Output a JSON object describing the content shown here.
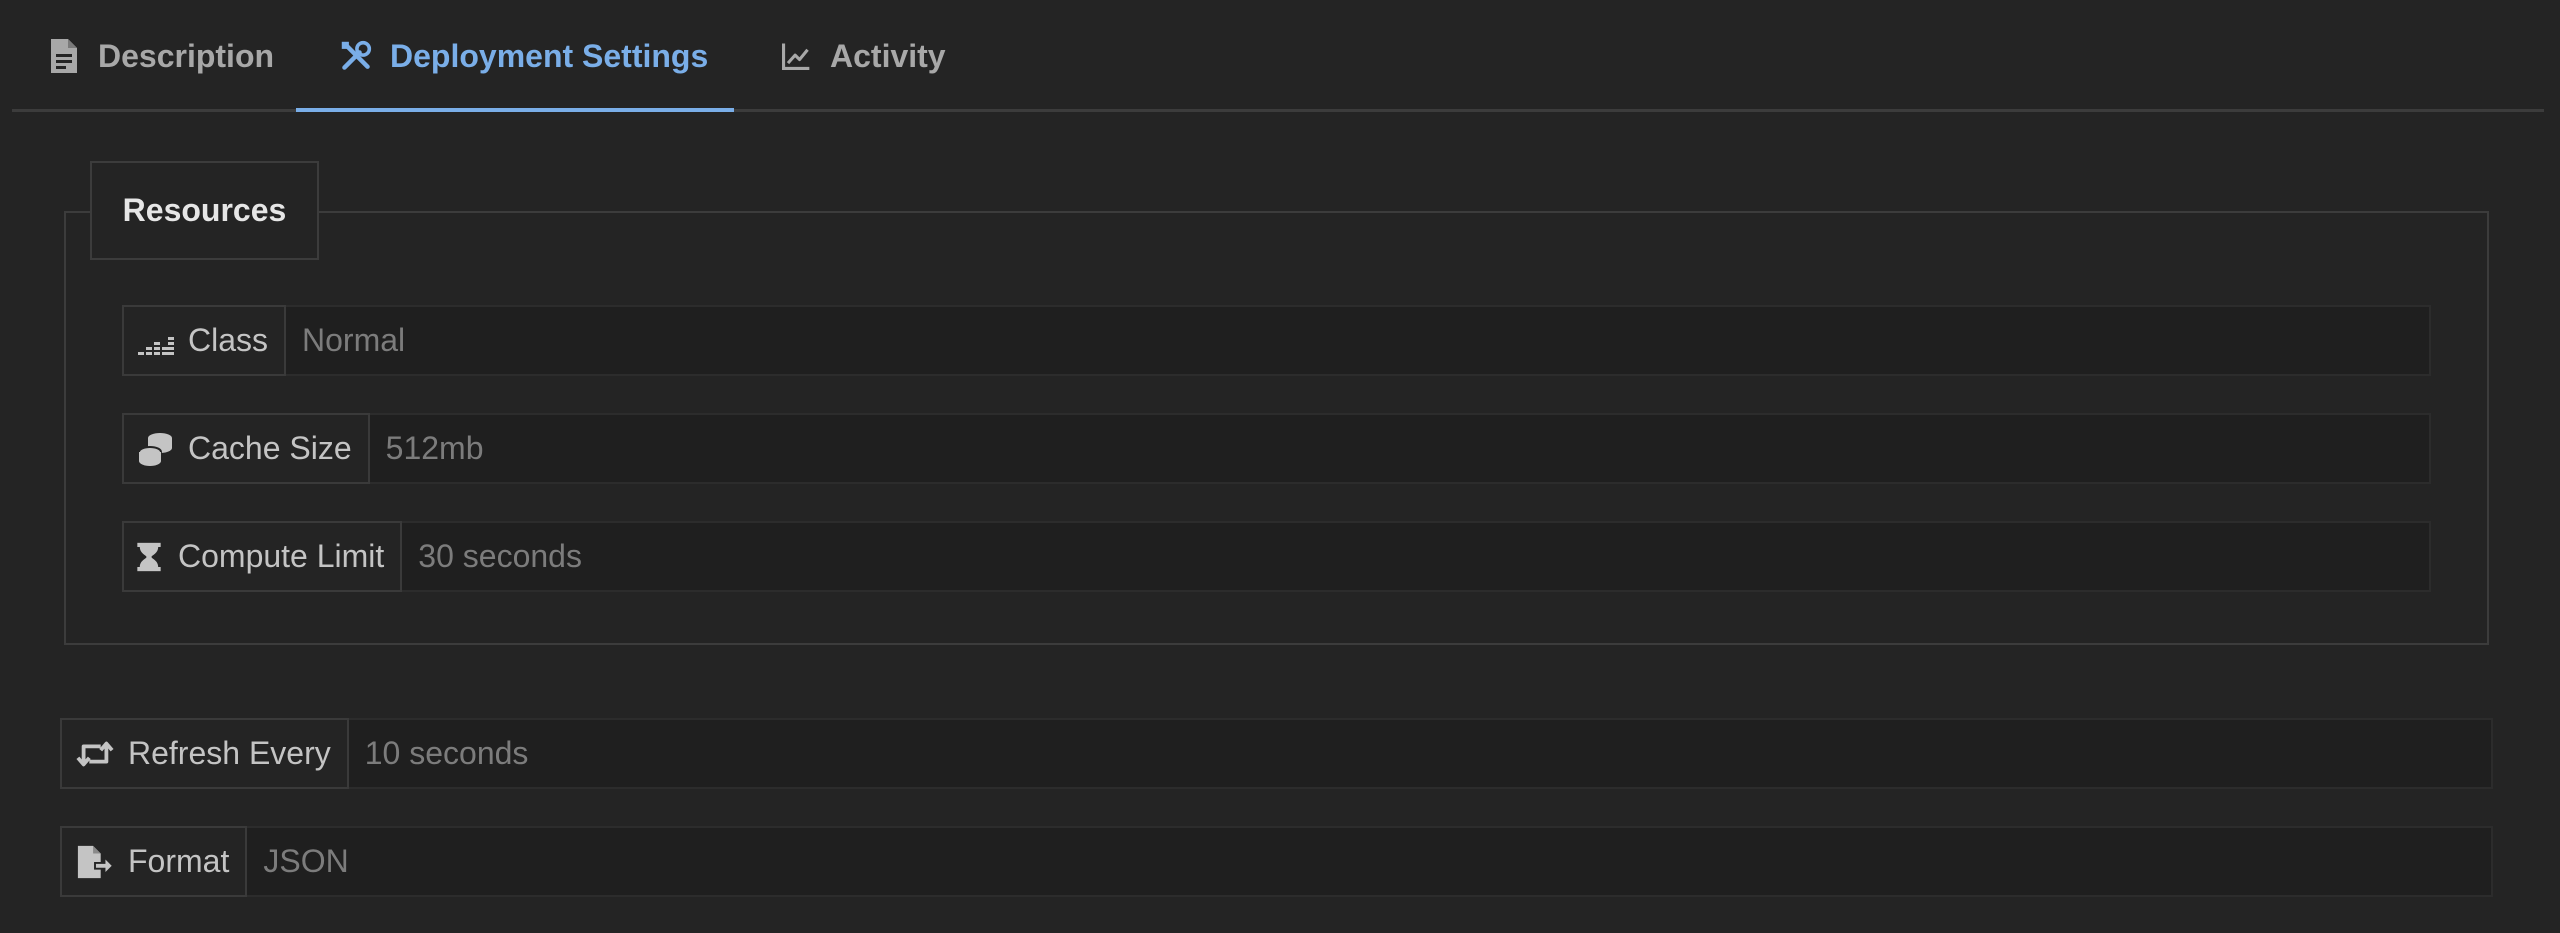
{
  "tabs": [
    {
      "label": "Description",
      "icon": "file-icon",
      "active": false
    },
    {
      "label": "Deployment Settings",
      "icon": "tools-icon",
      "active": true
    },
    {
      "label": "Activity",
      "icon": "chart-line-icon",
      "active": false
    }
  ],
  "resources": {
    "legend": "Resources",
    "fields": [
      {
        "label": "Class",
        "value": "Normal",
        "icon": "equalizer-icon"
      },
      {
        "label": "Cache Size",
        "value": "512mb",
        "icon": "coins-icon"
      },
      {
        "label": "Compute Limit",
        "value": "30 seconds",
        "icon": "hourglass-icon"
      }
    ]
  },
  "fields": [
    {
      "label": "Refresh Every",
      "value": "10 seconds",
      "icon": "retweet-icon"
    },
    {
      "label": "Format",
      "value": "JSON",
      "icon": "file-export-icon"
    }
  ],
  "colors": {
    "accent": "#7aaee8",
    "background": "#242424"
  }
}
